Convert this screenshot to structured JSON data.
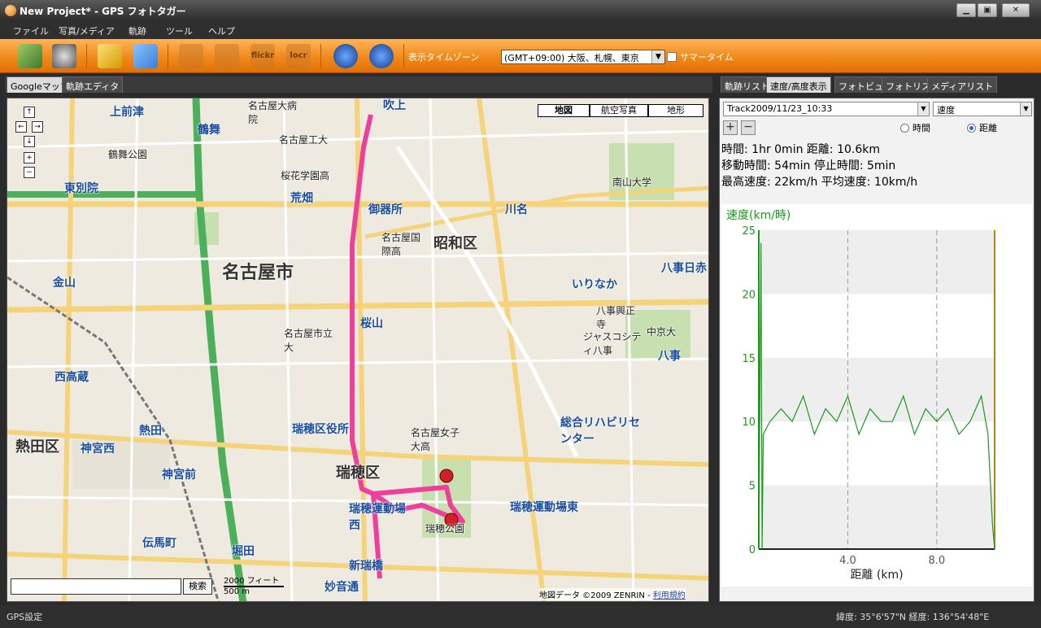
{
  "window": {
    "title": "New Project* - GPS フォトタガー",
    "minimize": "▁",
    "maximize": "▣",
    "close": "✕"
  },
  "menu": [
    "ファイル",
    "写真/メディア",
    "軌跡",
    "ツール",
    "ヘルプ"
  ],
  "toolbar": {
    "timezone_label": "表示タイムゾーン",
    "timezone_value": "(GMT+09:00) 大阪、札幌、東京",
    "summer_time_label": "サマータイム",
    "flickr_label": "flickr",
    "locr_label": "locr"
  },
  "left_tabs": [
    "Googleマップ",
    "軌跡エディタ"
  ],
  "map": {
    "types": [
      "地図",
      "航空写真",
      "地形"
    ],
    "search_button": "検索",
    "scale_top": "2000 フィート",
    "scale_bottom": "500 m",
    "copyright": "地図データ ©2009 ZENRIN -",
    "terms_link": "利用規約",
    "labels": {
      "nagoya_city": "名古屋市",
      "showa_ku": "昭和区",
      "mizuho_ku": "瑞穂区",
      "atsuta_ku": "熱田区",
      "kamimaezu": "上前津",
      "tsurumai": "鶴舞",
      "arahata": "荒畑",
      "gokisho": "御器所",
      "kawana": "川名",
      "higashibetsuin": "東別院",
      "kanayama": "金山",
      "sakurayama": "桜山",
      "nishitakakura": "西高蔵",
      "jingu_nishi": "神宮西",
      "jingu_mae": "神宮前",
      "atsuta": "熱田",
      "denmacho": "伝馬町",
      "horita": "堀田",
      "shinmizuho": "新瑞橋",
      "myoonji": "妙音通",
      "iriinaka": "いりなか",
      "yagoto_nisseki": "八事日赤",
      "yagoto": "八事",
      "mizuho_kuyakusho": "瑞穂区役所",
      "mizuho_undojo_nishi": "瑞穂運動場西",
      "mizuho_undojo_higashi": "瑞穂運動場東",
      "sogo_rehab": "総合リハビリセンター",
      "fukiage": "吹上",
      "nagoya_daigaku": "名古屋大病院",
      "nagoya_kodai": "名古屋工大",
      "tsurumai_park": "鶴舞公園",
      "sakura_gakuen": "桜花学園高",
      "nagoya_kokusai": "名古屋国際高",
      "nanzan_univ": "南山大学",
      "chukyo_univ": "中京大",
      "nagoya_shiritsu": "名古屋市立大",
      "yagoto_kosho": "八事興正寺",
      "jasco_yagoto": "ジャスコシティ八事",
      "mizuho_koen": "瑞穂公園",
      "mizuho_kodai": "名古屋女子大高"
    }
  },
  "right_tabs": [
    "軌跡リスト",
    "速度/高度表示",
    "フォトビュー",
    "フォトリスト",
    "メディアリスト"
  ],
  "track_panel": {
    "track_select": "Track2009/11/23_10:33",
    "metric_select": "速度",
    "add_button": "+",
    "remove_button": "−",
    "radio_time": "時間",
    "radio_distance": "距離",
    "stats": [
      "時間: 1hr 0min  距離: 10.6km",
      "移動時間: 54min  停止時間: 5min",
      "最高速度: 22km/h  平均速度: 10km/h"
    ]
  },
  "chart_data": {
    "type": "line",
    "title": "",
    "ylabel": "速度(km/時)",
    "xlabel": "距離 (km)",
    "xlim": [
      0,
      10.6
    ],
    "ylim": [
      0,
      25
    ],
    "yticks": [
      0,
      5,
      10,
      15,
      20,
      25
    ],
    "xticks": [
      4.0,
      8.0
    ],
    "grid": true,
    "series": [
      {
        "color": "#1a9a1a",
        "x": [
          0,
          0.1,
          0.15,
          0.2,
          0.5,
          1,
          1.5,
          2,
          2.5,
          3,
          3.5,
          4,
          4.5,
          5,
          5.5,
          6,
          6.5,
          7,
          7.5,
          8,
          8.5,
          9,
          9.5,
          10,
          10.3,
          10.5,
          10.55,
          10.6
        ],
        "y": [
          0,
          24,
          0,
          9,
          10,
          11,
          10,
          12,
          9,
          11,
          10,
          12,
          9,
          11,
          10,
          10,
          12,
          9,
          11,
          10,
          11,
          9,
          10,
          12,
          9,
          2,
          1,
          0
        ]
      }
    ]
  },
  "status": {
    "left": "GPS設定",
    "coords": "緯度: 35°6'57\"N  経度: 136°54'48\"E"
  }
}
